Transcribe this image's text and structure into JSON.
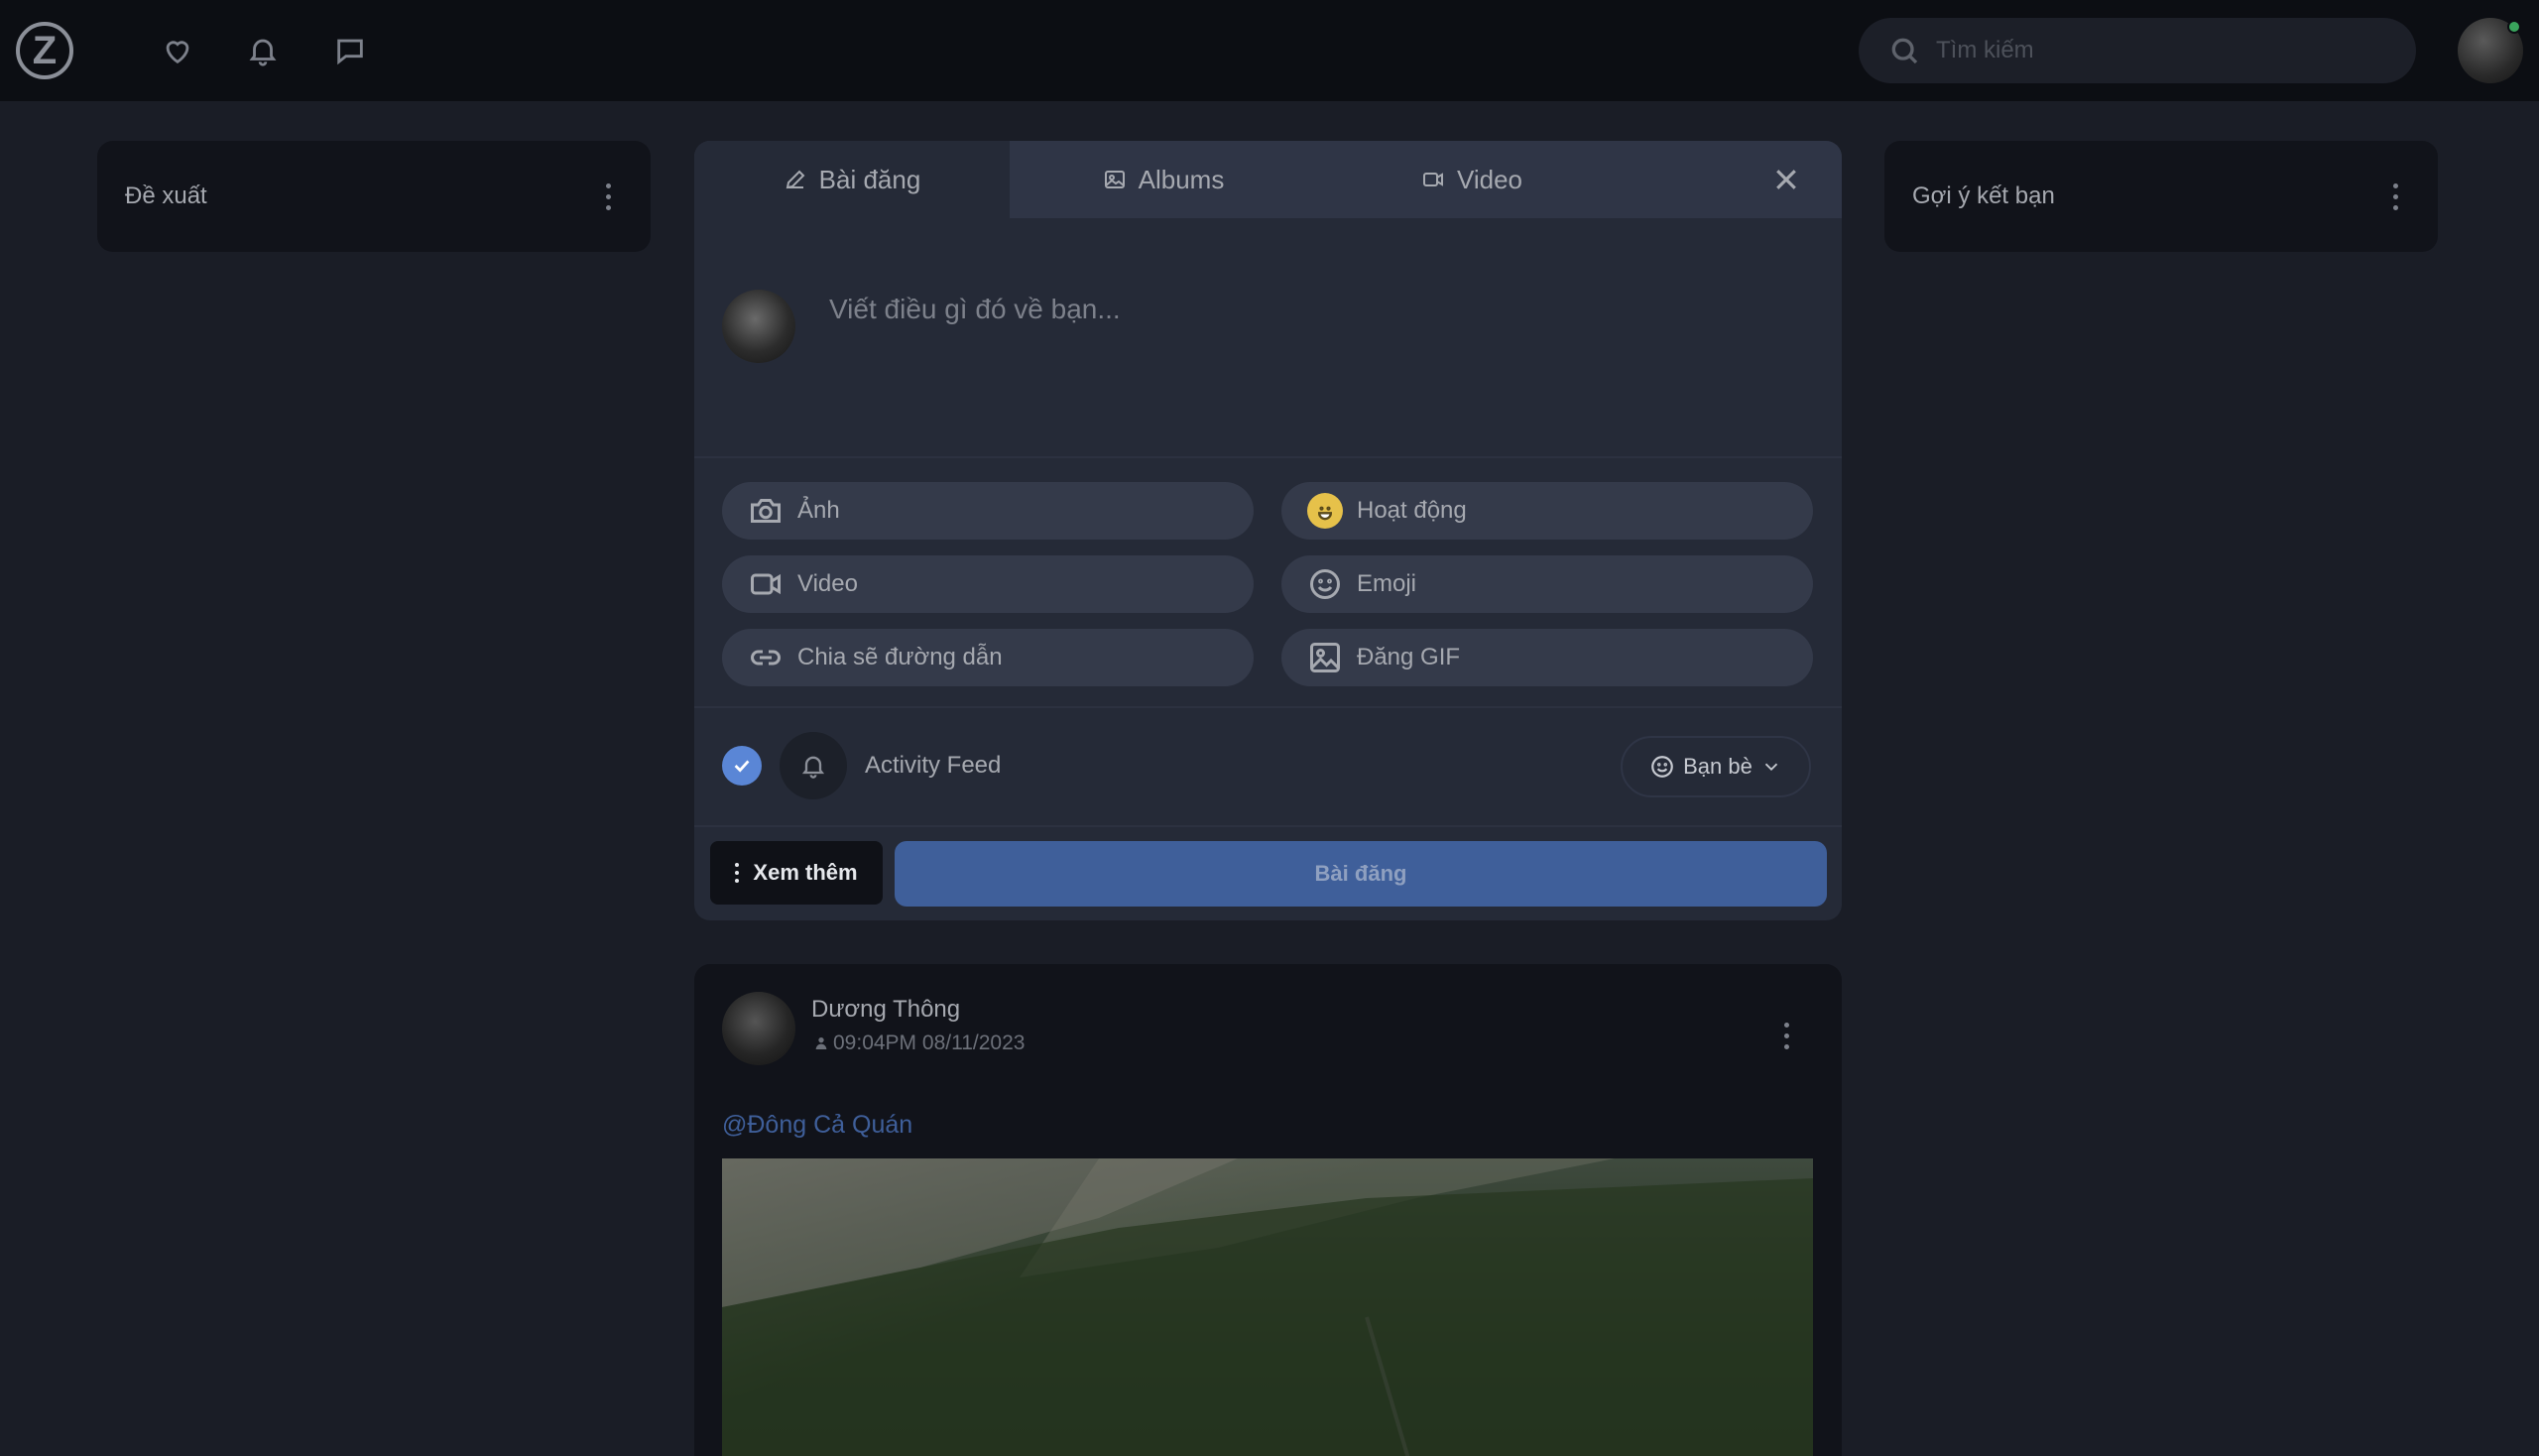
{
  "header": {
    "logo_text": "Z",
    "search_placeholder": "Tìm kiếm",
    "icons": [
      "heart-icon",
      "bell-icon",
      "message-icon"
    ]
  },
  "left_card": {
    "title": "Đề xuất"
  },
  "right_card": {
    "title": "Gợi ý kết bạn"
  },
  "composer": {
    "tabs": [
      {
        "label": "Bài đăng",
        "icon": "pencil-icon",
        "active": true
      },
      {
        "label": "Albums",
        "icon": "image-icon",
        "active": false
      },
      {
        "label": "Video",
        "icon": "video-icon",
        "active": false
      }
    ],
    "placeholder": "Viết điều gì đó về bạn...",
    "options": [
      {
        "label": "Ảnh",
        "icon": "camera-icon"
      },
      {
        "label": "Hoạt động",
        "icon": "smiley-yellow-icon"
      },
      {
        "label": "Video",
        "icon": "video-icon"
      },
      {
        "label": "Emoji",
        "icon": "smile-icon"
      },
      {
        "label": "Chia sẽ đường dẫn",
        "icon": "link-icon"
      },
      {
        "label": "Đăng GIF",
        "icon": "gif-image-icon"
      }
    ],
    "activity_feed_label": "Activity Feed",
    "activity_feed_checked": true,
    "privacy_label": "Bạn bè",
    "more_label": "Xem thêm",
    "post_label": "Bài đăng",
    "colors": {
      "accent": "#5a86d6",
      "post_button": "#3f5f9a"
    }
  },
  "post": {
    "author": "Dương Thông",
    "timestamp": "09:04PM 08/11/2023",
    "mention": "@Đông Cả Quán"
  }
}
